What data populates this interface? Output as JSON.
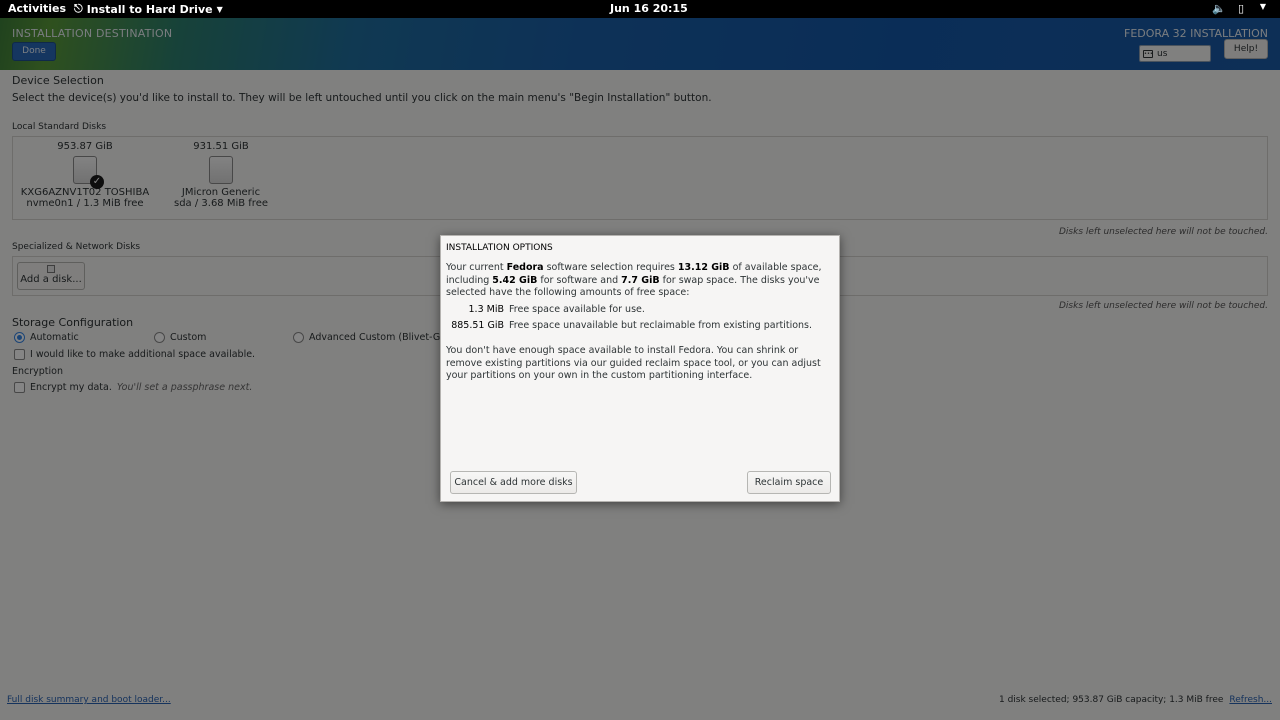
{
  "topbar": {
    "activities": "Activities",
    "app_menu": "Install to Hard Drive",
    "clock": "Jun 16  20:15"
  },
  "header": {
    "title": "INSTALLATION DESTINATION",
    "done_label": "Done",
    "product": "FEDORA 32 INSTALLATION",
    "keyboard_layout": "us",
    "help_label": "Help!"
  },
  "device_selection": {
    "heading": "Device Selection",
    "description": "Select the device(s) you'd like to install to.  They will be left untouched until you click on the main menu's \"Begin Installation\" button.",
    "local_heading": "Local Standard Disks",
    "disks": [
      {
        "size": "953.87 GiB",
        "name": "KXG6AZNV1T02 TOSHIBA",
        "detail": "nvme0n1  /  1.3 MiB free",
        "selected": true
      },
      {
        "size": "931.51 GiB",
        "name": "JMicron Generic",
        "detail": "sda  /  3.68 MiB free",
        "selected": false
      }
    ],
    "untouched_note": "Disks left unselected here will not be touched.",
    "network_heading": "Specialized & Network Disks",
    "add_disk_label": "Add a disk...",
    "network_note": "Disks left unselected here will not be touched."
  },
  "storage": {
    "heading": "Storage Configuration",
    "options": [
      "Automatic",
      "Custom",
      "Advanced Custom (Blivet-GUI)"
    ],
    "selected": "Automatic",
    "additional_space": "I would like to make additional space available.",
    "encryption_heading": "Encryption",
    "encrypt_label": "Encrypt my data.",
    "encrypt_hint": "You'll set a passphrase next."
  },
  "footer": {
    "summary_link": "Full disk summary and boot loader...",
    "status": "1 disk selected; 953.87 GiB capacity; 1.3 MiB free",
    "refresh_link": "Refresh..."
  },
  "dialog": {
    "title": "INSTALLATION OPTIONS",
    "p1_a": "Your current ",
    "p1_product": "Fedora",
    "p1_b": " software selection requires ",
    "p1_total": "13.12 GiB",
    "p1_c": " of available space, including ",
    "p1_software": "5.42 GiB",
    "p1_d": " for software and ",
    "p1_swap": "7.7 GiB",
    "p1_e": " for swap space. The disks you've selected have the following amounts of free space:",
    "free_amount": "1.3 MiB",
    "free_label": "Free space available for use.",
    "reclaim_amount": "885.51 GiB",
    "reclaim_label": "Free space unavailable but reclaimable from existing partitions.",
    "p2": "You don't have enough space available to install Fedora.  You can shrink or remove existing partitions via our guided reclaim space tool, or you can adjust your partitions on your own in the custom partitioning interface.",
    "cancel_label": "Cancel & add more disks",
    "reclaim_button": "Reclaim space"
  },
  "colors": {
    "accent": "#3584e4",
    "done_button": "#2a69b8",
    "link": "#2a63b2"
  }
}
